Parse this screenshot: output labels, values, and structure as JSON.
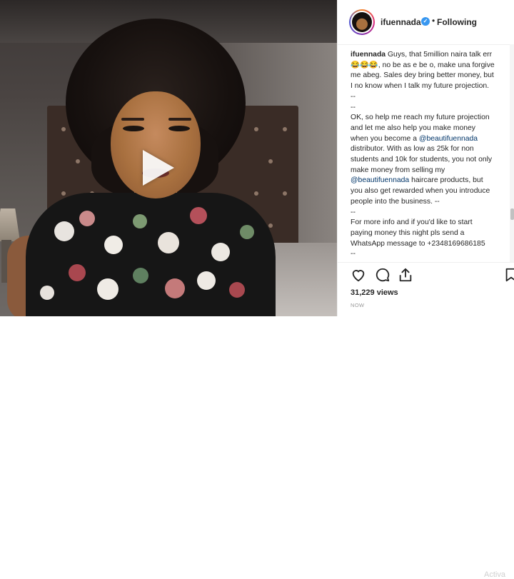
{
  "post": {
    "username": "ifuennada",
    "follow_status": "Following",
    "verified": true,
    "caption_lines": [
      "Guys, that 5million naira talk err",
      "😂😂😂, no be as e be o, make una forgive",
      "me abeg. Sales dey bring better money, but",
      "I no know when I talk my future projection.",
      "--",
      "--",
      "OK, so help me reach my future projection",
      "and let me also help you make money",
      "when you become a",
      "@beautifuennada",
      "distributor. With as low as 25k for non",
      "students and 10k for students, you not only",
      "make money from selling my",
      "@beautifuennada",
      "haircare products, but",
      "you also get rewarded when you introduce",
      "people into the business. --",
      "--",
      "For more info and if you'd like to start",
      "paying money this night pls send a",
      "WhatsApp message to +2348169686185",
      "--"
    ],
    "views": "31,229 views",
    "timestamp": "NOW",
    "watermark": "Activa"
  },
  "icons": {
    "like": "heart-icon",
    "comment": "comment-icon",
    "share": "share-icon",
    "save": "bookmark-icon",
    "play": "play-icon"
  },
  "colors": {
    "verified_blue": "#3897f0",
    "mention_blue": "#003569",
    "text": "#262626",
    "muted": "#999999"
  }
}
